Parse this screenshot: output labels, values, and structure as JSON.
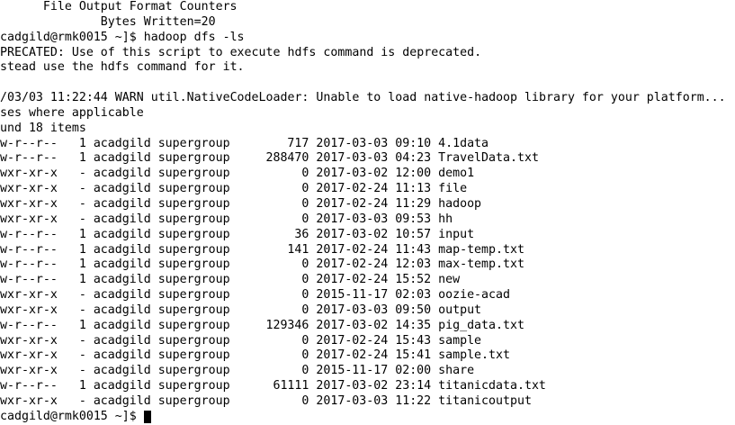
{
  "terminal": {
    "colors": {
      "background": "#ffffff",
      "foreground": "#000000",
      "cursor": "#000000"
    },
    "counters": {
      "group_name": "File Output Format Counters",
      "bytes_written": "Bytes Written=20"
    },
    "command_line": {
      "prompt": "cadgild@rmk0015 ~]$",
      "command": "hadoop dfs -ls"
    },
    "deprecation_notice": [
      "PRECATED: Use of this script to execute hdfs command is deprecated.",
      "stead use the hdfs command for it."
    ],
    "warning": [
      "/03/03 11:22:44 WARN util.NativeCodeLoader: Unable to load native-hadoop library for your platform...",
      "ses where applicable"
    ],
    "found_items": "und 18 items",
    "listing": [
      {
        "permissions": "w-r--r--",
        "replication": "1",
        "owner": "acadgild",
        "group": "supergroup",
        "bytes": 717,
        "date": "2017-03-03",
        "time": "09:10",
        "name": "4.1data"
      },
      {
        "permissions": "w-r--r--",
        "replication": "1",
        "owner": "acadgild",
        "group": "supergroup",
        "bytes": 288470,
        "date": "2017-03-03",
        "time": "04:23",
        "name": "TravelData.txt"
      },
      {
        "permissions": "wxr-xr-x",
        "replication": "-",
        "owner": "acadgild",
        "group": "supergroup",
        "bytes": 0,
        "date": "2017-03-02",
        "time": "12:00",
        "name": "demo1"
      },
      {
        "permissions": "wxr-xr-x",
        "replication": "-",
        "owner": "acadgild",
        "group": "supergroup",
        "bytes": 0,
        "date": "2017-02-24",
        "time": "11:13",
        "name": "file"
      },
      {
        "permissions": "wxr-xr-x",
        "replication": "-",
        "owner": "acadgild",
        "group": "supergroup",
        "bytes": 0,
        "date": "2017-02-24",
        "time": "11:29",
        "name": "hadoop"
      },
      {
        "permissions": "wxr-xr-x",
        "replication": "-",
        "owner": "acadgild",
        "group": "supergroup",
        "bytes": 0,
        "date": "2017-03-03",
        "time": "09:53",
        "name": "hh"
      },
      {
        "permissions": "w-r--r--",
        "replication": "1",
        "owner": "acadgild",
        "group": "supergroup",
        "bytes": 36,
        "date": "2017-03-02",
        "time": "10:57",
        "name": "input"
      },
      {
        "permissions": "w-r--r--",
        "replication": "1",
        "owner": "acadgild",
        "group": "supergroup",
        "bytes": 141,
        "date": "2017-02-24",
        "time": "11:43",
        "name": "map-temp.txt"
      },
      {
        "permissions": "w-r--r--",
        "replication": "1",
        "owner": "acadgild",
        "group": "supergroup",
        "bytes": 0,
        "date": "2017-02-24",
        "time": "12:03",
        "name": "max-temp.txt"
      },
      {
        "permissions": "w-r--r--",
        "replication": "1",
        "owner": "acadgild",
        "group": "supergroup",
        "bytes": 0,
        "date": "2017-02-24",
        "time": "15:52",
        "name": "new"
      },
      {
        "permissions": "wxr-xr-x",
        "replication": "-",
        "owner": "acadgild",
        "group": "supergroup",
        "bytes": 0,
        "date": "2015-11-17",
        "time": "02:03",
        "name": "oozie-acad"
      },
      {
        "permissions": "wxr-xr-x",
        "replication": "-",
        "owner": "acadgild",
        "group": "supergroup",
        "bytes": 0,
        "date": "2017-03-03",
        "time": "09:50",
        "name": "output"
      },
      {
        "permissions": "w-r--r--",
        "replication": "1",
        "owner": "acadgild",
        "group": "supergroup",
        "bytes": 129346,
        "date": "2017-03-02",
        "time": "14:35",
        "name": "pig_data.txt"
      },
      {
        "permissions": "wxr-xr-x",
        "replication": "-",
        "owner": "acadgild",
        "group": "supergroup",
        "bytes": 0,
        "date": "2017-02-24",
        "time": "15:43",
        "name": "sample"
      },
      {
        "permissions": "wxr-xr-x",
        "replication": "-",
        "owner": "acadgild",
        "group": "supergroup",
        "bytes": 0,
        "date": "2017-02-24",
        "time": "15:41",
        "name": "sample.txt"
      },
      {
        "permissions": "wxr-xr-x",
        "replication": "-",
        "owner": "acadgild",
        "group": "supergroup",
        "bytes": 0,
        "date": "2015-11-17",
        "time": "02:00",
        "name": "share"
      },
      {
        "permissions": "w-r--r--",
        "replication": "1",
        "owner": "acadgild",
        "group": "supergroup",
        "bytes": 61111,
        "date": "2017-03-02",
        "time": "23:14",
        "name": "titanicdata.txt"
      },
      {
        "permissions": "wxr-xr-x",
        "replication": "-",
        "owner": "acadgild",
        "group": "supergroup",
        "bytes": 0,
        "date": "2017-03-03",
        "time": "11:22",
        "name": "titanicoutput"
      }
    ],
    "input_line": {
      "prompt": "cadgild@rmk0015 ~]$"
    }
  }
}
